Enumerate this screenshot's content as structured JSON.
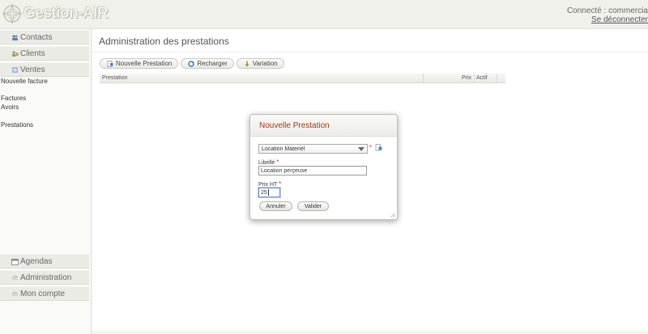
{
  "app": {
    "logo_text": "Gestion-AIR"
  },
  "user": {
    "status": "Connecté : commercia",
    "logout": "Se déconnecter"
  },
  "sidebar": {
    "sections": [
      {
        "label": "Contacts",
        "icon": "contacts-icon"
      },
      {
        "label": "Clients",
        "icon": "clients-icon"
      },
      {
        "label": "Ventes",
        "icon": "ventes-icon"
      }
    ],
    "ventes_items": [
      "Nouvelle facture",
      "Factures",
      "Avoirs",
      "Prestations"
    ],
    "bottom_sections": [
      {
        "label": "Agendas",
        "icon": "calendar-icon"
      },
      {
        "label": "Administration",
        "icon": "admin-icon"
      },
      {
        "label": "Mon compte",
        "icon": "account-icon"
      }
    ]
  },
  "main": {
    "title": "Administration des prestations",
    "toolbar": {
      "new_label": "Nouvelle Prestation",
      "reload_label": "Recharger",
      "variation_label": "Variation"
    },
    "grid": {
      "columns": [
        "Prestation",
        "Prix",
        "Actif"
      ]
    }
  },
  "dialog": {
    "title": "Nouvelle Prestation",
    "category_value": "Location Materiel",
    "libelle_label": "Libellé",
    "libelle_value": "Location perçeuse",
    "prix_label": "Prix HT",
    "prix_value": "25",
    "required_mark": "*",
    "cancel_label": "Annuler",
    "validate_label": "Valider"
  }
}
